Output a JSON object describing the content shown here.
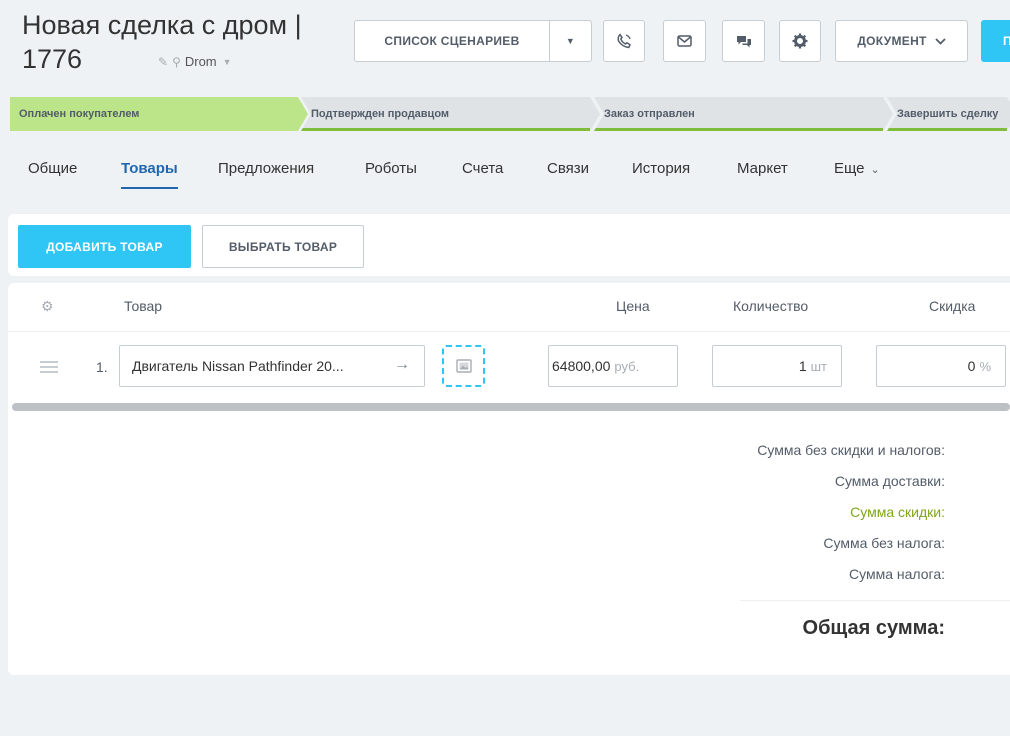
{
  "header": {
    "title_line1": "Новая сделка с дром |",
    "title_line2": "1776",
    "source": "Drom",
    "buttons": {
      "scenarios": "СПИСОК СЦЕНАРИЕВ",
      "document": "ДОКУМЕНТ",
      "primary": "П"
    },
    "icons": [
      "phone-icon",
      "mail-icon",
      "chat-icon",
      "gear-icon"
    ]
  },
  "stages": [
    {
      "label": "Оплачен покупателем",
      "color": "#bce58a",
      "line": "#bce58a"
    },
    {
      "label": "Подтвержден продавцом",
      "color": "#dfe3e6",
      "line": "#7fbd3a"
    },
    {
      "label": "Заказ отправлен",
      "color": "#dfe3e6",
      "line": "#7fbd3a"
    },
    {
      "label": "Завершить сделку",
      "color": "#dfe3e6",
      "line": "#7fbd3a"
    }
  ],
  "tabs": [
    {
      "label": "Общие"
    },
    {
      "label": "Товары",
      "active": true
    },
    {
      "label": "Предложения"
    },
    {
      "label": "Роботы"
    },
    {
      "label": "Счета"
    },
    {
      "label": "Связи"
    },
    {
      "label": "История"
    },
    {
      "label": "Маркет"
    },
    {
      "label": "Еще"
    }
  ],
  "toolbar": {
    "add_label": "ДОБАВИТЬ ТОВАР",
    "select_label": "ВЫБРАТЬ ТОВАР"
  },
  "table": {
    "columns": {
      "product": "Товар",
      "price": "Цена",
      "quantity": "Количество",
      "discount": "Скидка"
    },
    "rows": [
      {
        "num": "1.",
        "product": "Двигатель Nissan Pathfinder 20...",
        "price": "64800,00",
        "currency": "руб.",
        "quantity": "1",
        "quantity_unit": "шт",
        "discount": "0",
        "discount_unit": "%"
      }
    ]
  },
  "summary": {
    "subtotal": "Сумма без скидки и налогов:",
    "delivery": "Сумма доставки:",
    "discount": "Сумма скидки:",
    "without_tax": "Сумма без налога:",
    "tax": "Сумма налога:",
    "total": "Общая сумма:"
  },
  "colors": {
    "accent": "#2fc6f6",
    "active_tab": "#2067b0",
    "discount_label": "#7fa51c"
  }
}
